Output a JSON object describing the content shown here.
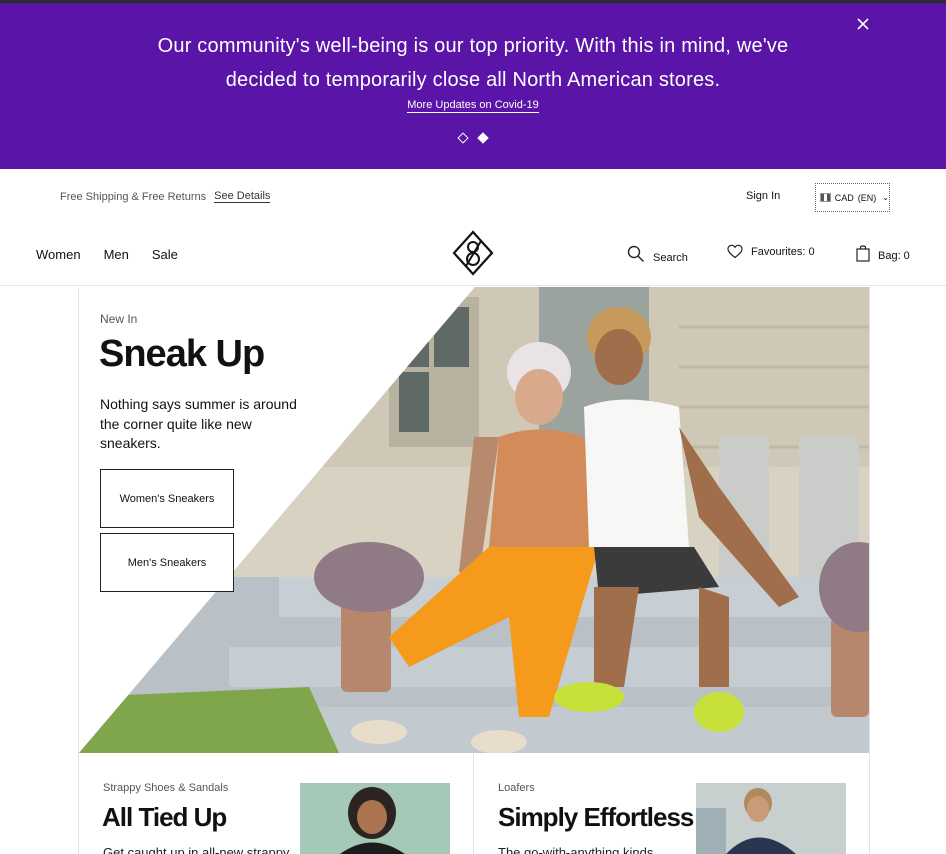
{
  "banner": {
    "message_line1": "Our community's well-being is our top priority. With this in mind, we've",
    "message_line2": "decided to temporarily close all North American stores.",
    "link": "More Updates on Covid-19",
    "close_icon": "close-icon",
    "slides_total": 2,
    "active_slide": 2,
    "color": "#5a14a8"
  },
  "utility": {
    "shipping_text": "Free Shipping & Free Returns",
    "details_link": "See Details",
    "sign_in": "Sign In",
    "currency": "CAD",
    "language": "(EN)"
  },
  "nav": {
    "items": [
      "Women",
      "Men",
      "Sale"
    ],
    "search_label": "Search",
    "favourites_label": "Favourites: 0",
    "bag_label": "Bag: 0"
  },
  "hero": {
    "eyebrow": "New In",
    "title": "Sneak Up",
    "description": "Nothing says summer is around the corner quite like new sneakers.",
    "buttons": [
      "Women's Sneakers",
      "Men's Sneakers"
    ]
  },
  "cards": [
    {
      "eyebrow": "Strappy Shoes & Sandals",
      "title": "All Tied Up",
      "description": "Get caught up in all-new strappy"
    },
    {
      "eyebrow": "Loafers",
      "title": "Simply Effortless",
      "description": "The go-with-anything kinds"
    }
  ]
}
